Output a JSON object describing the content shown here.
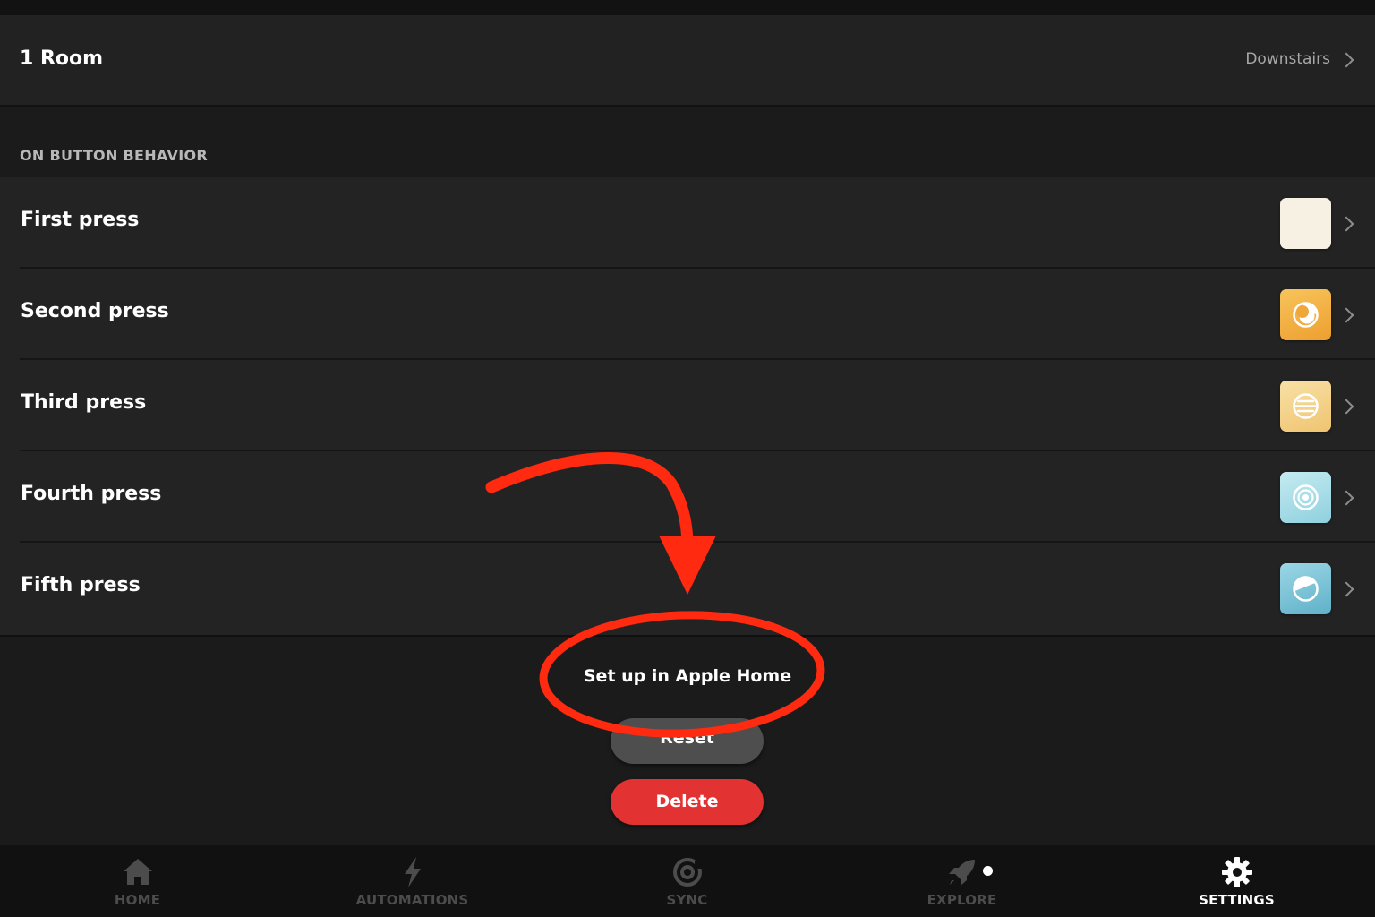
{
  "room": {
    "title": "1 Room",
    "value": "Downstairs"
  },
  "on_button_behavior": {
    "header": "ON BUTTON BEHAVIOR",
    "presses": [
      {
        "label": "First press",
        "swatch_color": "#f7f1e4",
        "icon": "none"
      },
      {
        "label": "Second press",
        "swatch_color": "#f2b648",
        "icon": "dimmed-moon-icon"
      },
      {
        "label": "Third press",
        "swatch_color": "#f4d28c",
        "icon": "read-lines-icon"
      },
      {
        "label": "Fourth press",
        "swatch_color": "#aadce6",
        "icon": "concentrate-target-icon"
      },
      {
        "label": "Fifth press",
        "swatch_color": "#7cc2d6",
        "icon": "energize-half-icon"
      }
    ]
  },
  "actions": {
    "setup_label": "Set up in Apple Home",
    "reset_label": "Reset",
    "delete_label": "Delete"
  },
  "annotation": {
    "color": "#ff2a0f"
  },
  "tabbar": {
    "tabs": [
      {
        "label": "HOME",
        "icon": "home-icon",
        "active": false
      },
      {
        "label": "AUTOMATIONS",
        "icon": "bolt-icon",
        "active": false
      },
      {
        "label": "SYNC",
        "icon": "sync-icon",
        "active": false
      },
      {
        "label": "EXPLORE",
        "icon": "rocket-icon",
        "active": false,
        "badge": true
      },
      {
        "label": "SETTINGS",
        "icon": "gear-icon",
        "active": true
      }
    ]
  },
  "colors": {
    "background": "#1b1b1b",
    "row": "#232323",
    "delete": "#e23232",
    "reset": "#4e4e4e"
  }
}
